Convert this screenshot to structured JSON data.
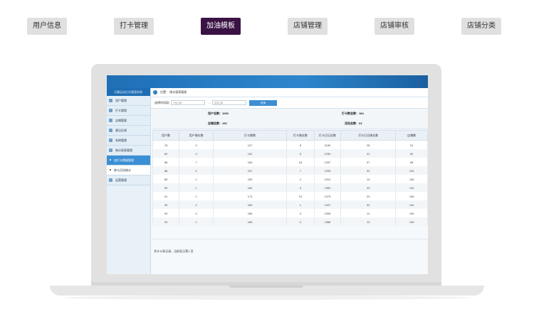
{
  "top_tabs": [
    {
      "label": "用户信息",
      "active": false
    },
    {
      "label": "打卡管理",
      "active": false
    },
    {
      "label": "加油模板",
      "active": true
    },
    {
      "label": "店铺管理",
      "active": false
    },
    {
      "label": "店铺审核",
      "active": false
    },
    {
      "label": "店铺分类",
      "active": false
    }
  ],
  "app": {
    "sidebar_title": "天舞运动后台管理系统",
    "sidebar": [
      {
        "label": "用户管理"
      },
      {
        "label": "打卡管理"
      },
      {
        "label": "店铺管理"
      },
      {
        "label": "意见反馈"
      },
      {
        "label": "系统管理"
      },
      {
        "label": "统计报表管理"
      }
    ],
    "sub_items": [
      {
        "label": "加打卡数据管理",
        "active": true
      },
      {
        "label": "参与活动统计",
        "active": false
      }
    ],
    "sidebar_last": {
      "label": "运营管理"
    },
    "breadcrumb": "位置： 统计报表管理",
    "filter": {
      "label": "选择时间段：",
      "start_placeholder": "开始日期",
      "dash": "-",
      "end_placeholder": "结束日期",
      "button": "查询"
    },
    "summary": {
      "users": "用户总数：1060",
      "checkins": "打卡数总数：184",
      "shops": "店铺总数：190",
      "activities": "活动总数：63"
    },
    "columns": [
      "用户数",
      "用户增长数",
      "打卡数数",
      "打卡增长数",
      "打卡日记总数",
      "打卡日记增长数",
      "店铺数"
    ],
    "rows": [
      [
        "78",
        "0",
        "127",
        "8",
        "1169",
        "28",
        "51"
      ],
      [
        "82",
        "4",
        "132",
        "5",
        "1230",
        "41",
        "52"
      ],
      [
        "88",
        "7",
        "150",
        "18",
        "1267",
        "37",
        "65"
      ],
      [
        "88",
        "0",
        "157",
        "7",
        "1299",
        "32",
        "124"
      ],
      [
        "89",
        "1",
        "159",
        "2",
        "1312",
        "14",
        "146"
      ],
      [
        "90",
        "1",
        "163",
        "4",
        "1352",
        "40",
        "142"
      ],
      [
        "91",
        "1",
        "173",
        "10",
        "1375",
        "23",
        "146"
      ],
      [
        "93",
        "2",
        "183",
        "1",
        "1407",
        "32",
        "140"
      ],
      [
        "93",
        "0",
        "166",
        "3",
        "1395",
        "11",
        "140"
      ],
      [
        "94",
        "1",
        "166",
        "0",
        "1388",
        "12",
        "140"
      ]
    ],
    "pager": "共计11条记录，当前显示第1 页"
  }
}
